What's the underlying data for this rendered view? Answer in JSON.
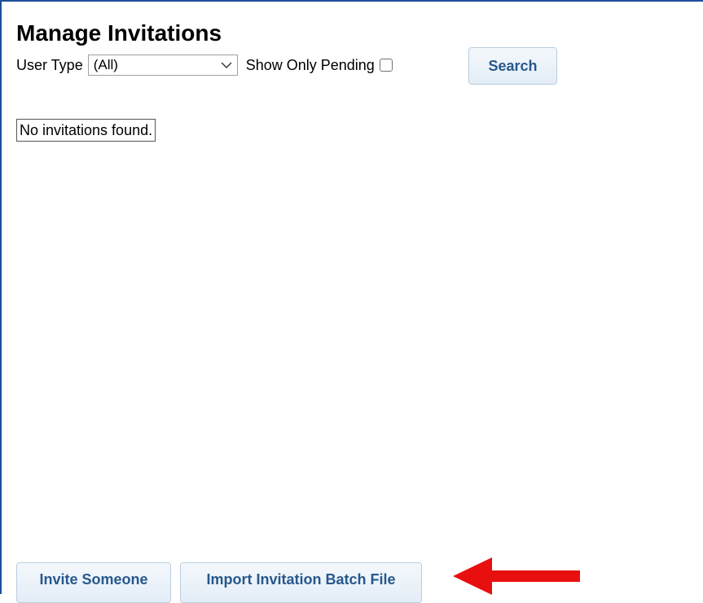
{
  "page": {
    "title": "Manage Invitations"
  },
  "filters": {
    "user_type_label": "User Type",
    "user_type_value": "(All)",
    "show_only_pending_label": "Show Only Pending",
    "show_only_pending_checked": false,
    "search_button_label": "Search"
  },
  "results": {
    "empty_message": "No invitations found."
  },
  "actions": {
    "invite_someone_label": "Invite Someone",
    "import_batch_label": "Import Invitation Batch File"
  },
  "annotation": {
    "arrow_color": "#e8100f",
    "arrow_icon": "left-arrow-icon"
  },
  "colors": {
    "frame_border": "#1f4e9c",
    "button_text": "#27588c",
    "button_border": "#b9cde0"
  }
}
